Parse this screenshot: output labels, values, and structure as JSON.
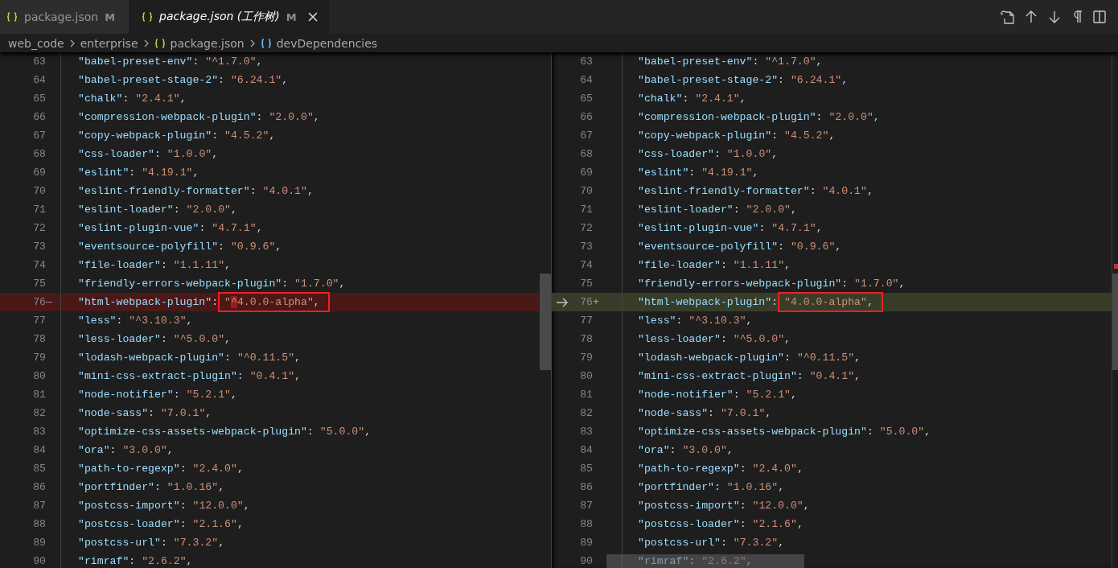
{
  "tabs": [
    {
      "label": "package.json",
      "badge": "M",
      "selected": false,
      "italic": false,
      "closable": false
    },
    {
      "label": "package.json (工作树)",
      "badge": "M",
      "selected": true,
      "italic": true,
      "closable": true
    }
  ],
  "breadcrumb": [
    {
      "label": "web_code",
      "kind": "folder"
    },
    {
      "label": "enterprise",
      "kind": "folder"
    },
    {
      "label": "package.json",
      "kind": "file"
    },
    {
      "label": "devDependencies",
      "kind": "object"
    }
  ],
  "left_pane": {
    "lines": [
      {
        "n": "63",
        "key": "\"babel-preset-env\"",
        "colon": ":",
        "value": "\"^1.7.0\"",
        "comma": ",",
        "kind": "context"
      },
      {
        "n": "64",
        "key": "\"babel-preset-stage-2\"",
        "colon": ":",
        "value": "\"6.24.1\"",
        "comma": ",",
        "kind": "context"
      },
      {
        "n": "65",
        "key": "\"chalk\"",
        "colon": ":",
        "value": "\"2.4.1\"",
        "comma": ",",
        "kind": "context"
      },
      {
        "n": "66",
        "key": "\"compression-webpack-plugin\"",
        "colon": ":",
        "value": "\"2.0.0\"",
        "comma": ",",
        "kind": "context"
      },
      {
        "n": "67",
        "key": "\"copy-webpack-plugin\"",
        "colon": ":",
        "value": "\"4.5.2\"",
        "comma": ",",
        "kind": "context"
      },
      {
        "n": "68",
        "key": "\"css-loader\"",
        "colon": ":",
        "value": "\"1.0.0\"",
        "comma": ",",
        "kind": "context"
      },
      {
        "n": "69",
        "key": "\"eslint\"",
        "colon": ":",
        "value": "\"4.19.1\"",
        "comma": ",",
        "kind": "context"
      },
      {
        "n": "70",
        "key": "\"eslint-friendly-formatter\"",
        "colon": ":",
        "value": "\"4.0.1\"",
        "comma": ",",
        "kind": "context"
      },
      {
        "n": "71",
        "key": "\"eslint-loader\"",
        "colon": ":",
        "value": "\"2.0.0\"",
        "comma": ",",
        "kind": "context"
      },
      {
        "n": "72",
        "key": "\"eslint-plugin-vue\"",
        "colon": ":",
        "value": "\"4.7.1\"",
        "comma": ",",
        "kind": "context"
      },
      {
        "n": "73",
        "key": "\"eventsource-polyfill\"",
        "colon": ":",
        "value": "\"0.9.6\"",
        "comma": ",",
        "kind": "context"
      },
      {
        "n": "74",
        "key": "\"file-loader\"",
        "colon": ":",
        "value": "\"1.1.11\"",
        "comma": ",",
        "kind": "context"
      },
      {
        "n": "75",
        "key": "\"friendly-errors-webpack-plugin\"",
        "colon": ":",
        "value": "\"1.7.0\"",
        "comma": ",",
        "kind": "context"
      },
      {
        "n": "76",
        "marker": "—",
        "key": "\"html-webpack-plugin\"",
        "colon": ":",
        "value_parts": [
          {
            "text": "\"",
            "changed": false
          },
          {
            "text": "^",
            "changed": true
          },
          {
            "text": "4.0.0-alpha\"",
            "changed": false
          }
        ],
        "comma": ",",
        "kind": "removed",
        "boxed": true
      },
      {
        "n": "77",
        "key": "\"less\"",
        "colon": ":",
        "value": "\"^3.10.3\"",
        "comma": ",",
        "kind": "context"
      },
      {
        "n": "78",
        "key": "\"less-loader\"",
        "colon": ":",
        "value": "\"^5.0.0\"",
        "comma": ",",
        "kind": "context"
      },
      {
        "n": "79",
        "key": "\"lodash-webpack-plugin\"",
        "colon": ":",
        "value": "\"^0.11.5\"",
        "comma": ",",
        "kind": "context"
      },
      {
        "n": "80",
        "key": "\"mini-css-extract-plugin\"",
        "colon": ":",
        "value": "\"0.4.1\"",
        "comma": ",",
        "kind": "context"
      },
      {
        "n": "81",
        "key": "\"node-notifier\"",
        "colon": ":",
        "value": "\"5.2.1\"",
        "comma": ",",
        "kind": "context"
      },
      {
        "n": "82",
        "key": "\"node-sass\"",
        "colon": ":",
        "value": "\"7.0.1\"",
        "comma": ",",
        "kind": "context"
      },
      {
        "n": "83",
        "key": "\"optimize-css-assets-webpack-plugin\"",
        "colon": ":",
        "value": "\"5.0.0\"",
        "comma": ",",
        "kind": "context"
      },
      {
        "n": "84",
        "key": "\"ora\"",
        "colon": ":",
        "value": "\"3.0.0\"",
        "comma": ",",
        "kind": "context"
      },
      {
        "n": "85",
        "key": "\"path-to-regexp\"",
        "colon": ":",
        "value": "\"2.4.0\"",
        "comma": ",",
        "kind": "context"
      },
      {
        "n": "86",
        "key": "\"portfinder\"",
        "colon": ":",
        "value": "\"1.0.16\"",
        "comma": ",",
        "kind": "context"
      },
      {
        "n": "87",
        "key": "\"postcss-import\"",
        "colon": ":",
        "value": "\"12.0.0\"",
        "comma": ",",
        "kind": "context"
      },
      {
        "n": "88",
        "key": "\"postcss-loader\"",
        "colon": ":",
        "value": "\"2.1.6\"",
        "comma": ",",
        "kind": "context"
      },
      {
        "n": "89",
        "key": "\"postcss-url\"",
        "colon": ":",
        "value": "\"7.3.2\"",
        "comma": ",",
        "kind": "context"
      },
      {
        "n": "90",
        "key": "\"rimraf\"",
        "colon": ":",
        "value": "\"2.6.2\"",
        "comma": ",",
        "kind": "context"
      }
    ]
  },
  "right_pane": {
    "lines": [
      {
        "n": "63",
        "key": "\"babel-preset-env\"",
        "colon": ":",
        "value": "\"^1.7.0\"",
        "comma": ",",
        "kind": "context"
      },
      {
        "n": "64",
        "key": "\"babel-preset-stage-2\"",
        "colon": ":",
        "value": "\"6.24.1\"",
        "comma": ",",
        "kind": "context"
      },
      {
        "n": "65",
        "key": "\"chalk\"",
        "colon": ":",
        "value": "\"2.4.1\"",
        "comma": ",",
        "kind": "context"
      },
      {
        "n": "66",
        "key": "\"compression-webpack-plugin\"",
        "colon": ":",
        "value": "\"2.0.0\"",
        "comma": ",",
        "kind": "context"
      },
      {
        "n": "67",
        "key": "\"copy-webpack-plugin\"",
        "colon": ":",
        "value": "\"4.5.2\"",
        "comma": ",",
        "kind": "context"
      },
      {
        "n": "68",
        "key": "\"css-loader\"",
        "colon": ":",
        "value": "\"1.0.0\"",
        "comma": ",",
        "kind": "context"
      },
      {
        "n": "69",
        "key": "\"eslint\"",
        "colon": ":",
        "value": "\"4.19.1\"",
        "comma": ",",
        "kind": "context"
      },
      {
        "n": "70",
        "key": "\"eslint-friendly-formatter\"",
        "colon": ":",
        "value": "\"4.0.1\"",
        "comma": ",",
        "kind": "context"
      },
      {
        "n": "71",
        "key": "\"eslint-loader\"",
        "colon": ":",
        "value": "\"2.0.0\"",
        "comma": ",",
        "kind": "context"
      },
      {
        "n": "72",
        "key": "\"eslint-plugin-vue\"",
        "colon": ":",
        "value": "\"4.7.1\"",
        "comma": ",",
        "kind": "context"
      },
      {
        "n": "73",
        "key": "\"eventsource-polyfill\"",
        "colon": ":",
        "value": "\"0.9.6\"",
        "comma": ",",
        "kind": "context"
      },
      {
        "n": "74",
        "key": "\"file-loader\"",
        "colon": ":",
        "value": "\"1.1.11\"",
        "comma": ",",
        "kind": "context"
      },
      {
        "n": "75",
        "key": "\"friendly-errors-webpack-plugin\"",
        "colon": ":",
        "value": "\"1.7.0\"",
        "comma": ",",
        "kind": "context"
      },
      {
        "n": "76",
        "marker": "+",
        "key": "\"html-webpack-plugin\"",
        "colon": ":",
        "value": "\"4.0.0-alpha\"",
        "comma": ",",
        "kind": "added",
        "boxed": true,
        "current": true
      },
      {
        "n": "77",
        "key": "\"less\"",
        "colon": ":",
        "value": "\"^3.10.3\"",
        "comma": ",",
        "kind": "context"
      },
      {
        "n": "78",
        "key": "\"less-loader\"",
        "colon": ":",
        "value": "\"^5.0.0\"",
        "comma": ",",
        "kind": "context"
      },
      {
        "n": "79",
        "key": "\"lodash-webpack-plugin\"",
        "colon": ":",
        "value": "\"^0.11.5\"",
        "comma": ",",
        "kind": "context"
      },
      {
        "n": "80",
        "key": "\"mini-css-extract-plugin\"",
        "colon": ":",
        "value": "\"0.4.1\"",
        "comma": ",",
        "kind": "context"
      },
      {
        "n": "81",
        "key": "\"node-notifier\"",
        "colon": ":",
        "value": "\"5.2.1\"",
        "comma": ",",
        "kind": "context"
      },
      {
        "n": "82",
        "key": "\"node-sass\"",
        "colon": ":",
        "value": "\"7.0.1\"",
        "comma": ",",
        "kind": "context"
      },
      {
        "n": "83",
        "key": "\"optimize-css-assets-webpack-plugin\"",
        "colon": ":",
        "value": "\"5.0.0\"",
        "comma": ",",
        "kind": "context"
      },
      {
        "n": "84",
        "key": "\"ora\"",
        "colon": ":",
        "value": "\"3.0.0\"",
        "comma": ",",
        "kind": "context"
      },
      {
        "n": "85",
        "key": "\"path-to-regexp\"",
        "colon": ":",
        "value": "\"2.4.0\"",
        "comma": ",",
        "kind": "context"
      },
      {
        "n": "86",
        "key": "\"portfinder\"",
        "colon": ":",
        "value": "\"1.0.16\"",
        "comma": ",",
        "kind": "context"
      },
      {
        "n": "87",
        "key": "\"postcss-import\"",
        "colon": ":",
        "value": "\"12.0.0\"",
        "comma": ",",
        "kind": "context"
      },
      {
        "n": "88",
        "key": "\"postcss-loader\"",
        "colon": ":",
        "value": "\"2.1.6\"",
        "comma": ",",
        "kind": "context"
      },
      {
        "n": "89",
        "key": "\"postcss-url\"",
        "colon": ":",
        "value": "\"7.3.2\"",
        "comma": ",",
        "kind": "context"
      },
      {
        "n": "90",
        "key": "\"rimraf\"",
        "colon": ":",
        "value": "\"2.6.2\"",
        "comma": ",",
        "kind": "context"
      }
    ]
  }
}
